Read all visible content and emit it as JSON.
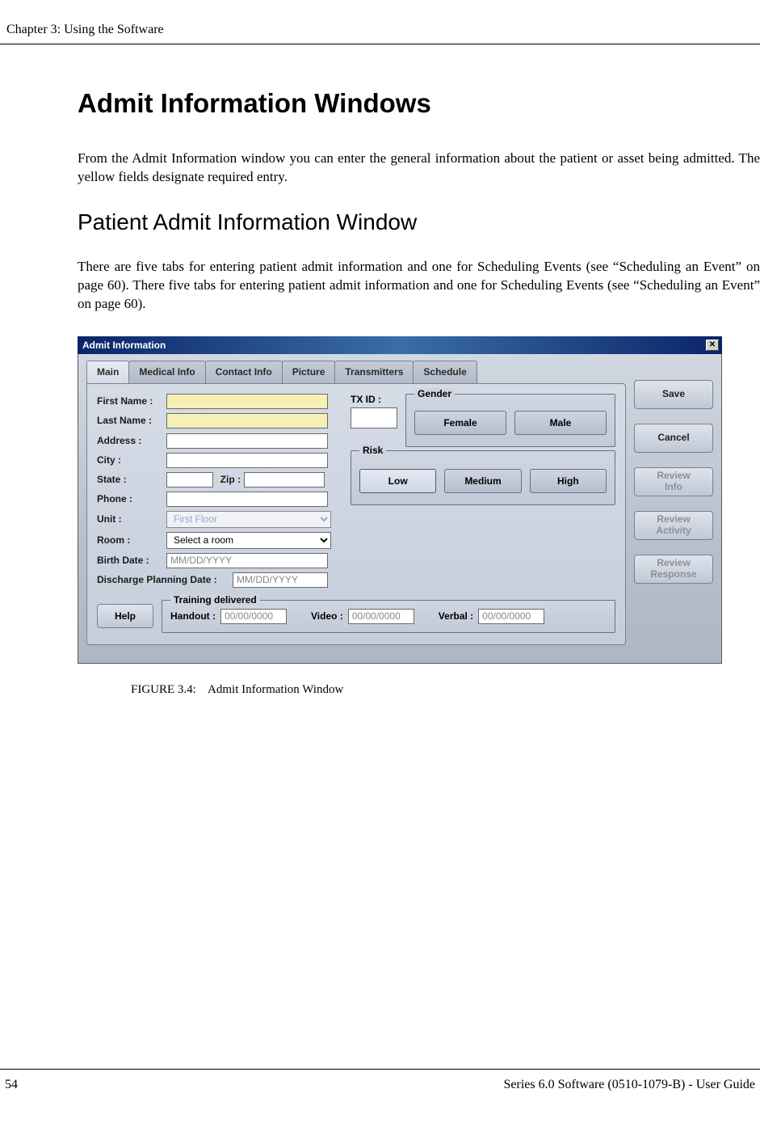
{
  "header": {
    "chapter": "Chapter 3: Using the Software"
  },
  "section": {
    "h1": "Admit Information Windows",
    "intro": "From the Admit Information window you can enter the general information about the patient or asset being admitted. The yellow fields designate required entry.",
    "h2": "Patient Admit Information Window",
    "body": "There are five tabs for entering patient admit information and one for Scheduling Events (see “Scheduling an Event” on page 60). There five tabs for entering patient admit information and one for Scheduling Events (see “Scheduling an Event” on page 60)."
  },
  "dialog": {
    "title": "Admit Information",
    "tabs": [
      "Main",
      "Medical Info",
      "Contact Info",
      "Picture",
      "Transmitters",
      "Schedule"
    ],
    "labels": {
      "first_name": "First Name :",
      "last_name": "Last Name :",
      "address": "Address :",
      "city": "City :",
      "state": "State :",
      "zip": "Zip :",
      "phone": "Phone :",
      "unit": "Unit :",
      "room": "Room :",
      "birth_date": "Birth Date :",
      "discharge": "Discharge Planning Date :",
      "txid": "TX ID :",
      "gender": "Gender",
      "risk": "Risk",
      "training": "Training delivered",
      "handout": "Handout :",
      "video": "Video :",
      "verbal": "Verbal :"
    },
    "placeholders": {
      "unit": "First Floor",
      "room": "Select a room",
      "birth_date": "MM/DD/YYYY",
      "discharge": "MM/DD/YYYY",
      "handout": "00/00/0000",
      "video": "00/00/0000",
      "verbal": "00/00/0000"
    },
    "gender_options": [
      "Female",
      "Male"
    ],
    "risk_options": [
      "Low",
      "Medium",
      "High"
    ],
    "buttons": {
      "save": "Save",
      "cancel": "Cancel",
      "review_info": "Review\nInfo",
      "review_activity": "Review\nActivity",
      "review_response": "Review\nResponse",
      "help": "Help"
    }
  },
  "caption": {
    "label": "FIGURE 3.4:",
    "text": "Admit Information Window"
  },
  "footer": {
    "page": "54",
    "right": "Series 6.0 Software (0510-1079-B) - User Guide"
  }
}
